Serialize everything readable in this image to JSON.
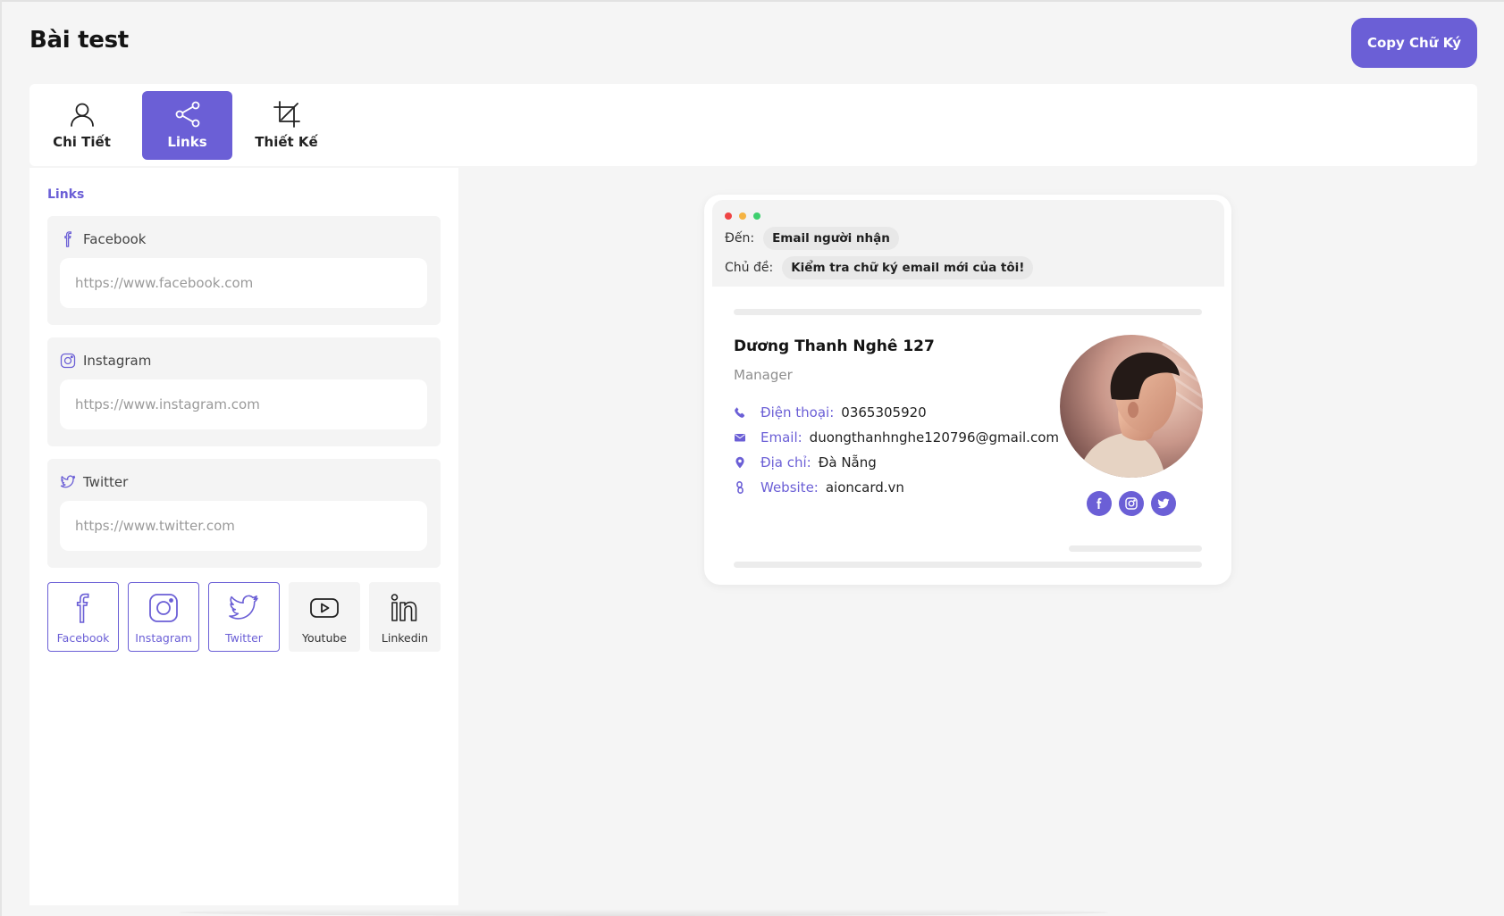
{
  "header": {
    "title": "Bài test",
    "copy_button": "Copy Chữ Ký"
  },
  "tabs": [
    {
      "label": "Chi Tiết",
      "icon": "user-icon",
      "active": false
    },
    {
      "label": "Links",
      "icon": "share-icon",
      "active": true
    },
    {
      "label": "Thiết Kế",
      "icon": "crop-icon",
      "active": false
    }
  ],
  "links_panel": {
    "section_label": "Links",
    "fields": [
      {
        "label": "Facebook",
        "icon": "facebook-icon",
        "value": "",
        "placeholder": "https://www.facebook.com"
      },
      {
        "label": "Instagram",
        "icon": "instagram-icon",
        "value": "",
        "placeholder": "https://www.instagram.com"
      },
      {
        "label": "Twitter",
        "icon": "twitter-icon",
        "value": "",
        "placeholder": "https://www.twitter.com"
      }
    ],
    "tiles": [
      {
        "label": "Facebook",
        "icon": "facebook-icon",
        "selected": true
      },
      {
        "label": "Instagram",
        "icon": "instagram-icon",
        "selected": true
      },
      {
        "label": "Twitter",
        "icon": "twitter-icon",
        "selected": true
      },
      {
        "label": "Youtube",
        "icon": "youtube-icon",
        "selected": false
      },
      {
        "label": "Linkedin",
        "icon": "linkedin-icon",
        "selected": false
      }
    ]
  },
  "preview": {
    "to_label": "Đến:",
    "to_value": "Email người nhận",
    "subject_label": "Chủ đề:",
    "subject_value": "Kiểm tra chữ ký email mới của tôi!",
    "window_dots": [
      "#ef4444",
      "#f5b342",
      "#3ecf6e"
    ],
    "signature": {
      "name": "Dương Thanh Nghê 127",
      "role": "Manager",
      "phone_label": "Điện thoại:",
      "phone": "0365305920",
      "email_label": "Email:",
      "email": "duongthanhnghe120796@gmail.com",
      "address_label": "Địa chỉ:",
      "address": "Đà Nẵng",
      "website_label": "Website:",
      "website": "aioncard.vn",
      "socials": [
        "facebook-icon",
        "instagram-icon",
        "twitter-icon"
      ]
    }
  },
  "colors": {
    "accent": "#6b5fd6",
    "background": "#f5f5f5",
    "panel": "#ffffff"
  }
}
